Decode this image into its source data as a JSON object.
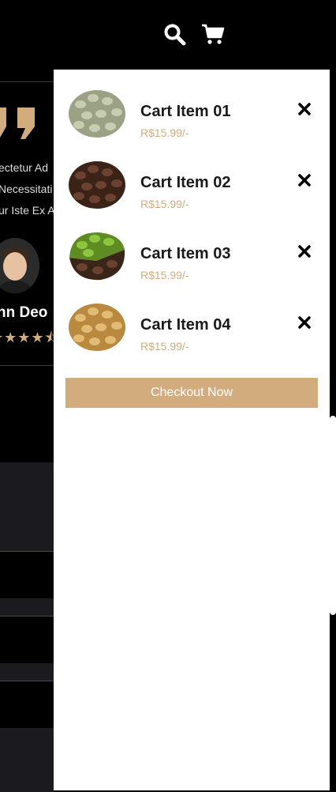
{
  "header": {
    "search_icon": "search-icon",
    "cart_icon": "cart-icon"
  },
  "background_review": {
    "lines": [
      "ectetur Ad",
      "Necessitati",
      "ur Iste Ex A"
    ],
    "reviewer": "nn Deo",
    "rating": 4.5,
    "accent": "#d3ac7d"
  },
  "cart": {
    "items": [
      {
        "title": "Cart Item 01",
        "price": "R$15.99/-",
        "bean": "green-coffee-beans"
      },
      {
        "title": "Cart Item 02",
        "price": "R$15.99/-",
        "bean": "dark-roast-coffee-beans"
      },
      {
        "title": "Cart Item 03",
        "price": "R$15.99/-",
        "bean": "mixed-coffee-beans"
      },
      {
        "title": "Cart Item 04",
        "price": "R$15.99/-",
        "bean": "light-roast-coffee-beans"
      }
    ],
    "checkout_label": "Checkout Now",
    "accent": "#d3ac7d"
  }
}
